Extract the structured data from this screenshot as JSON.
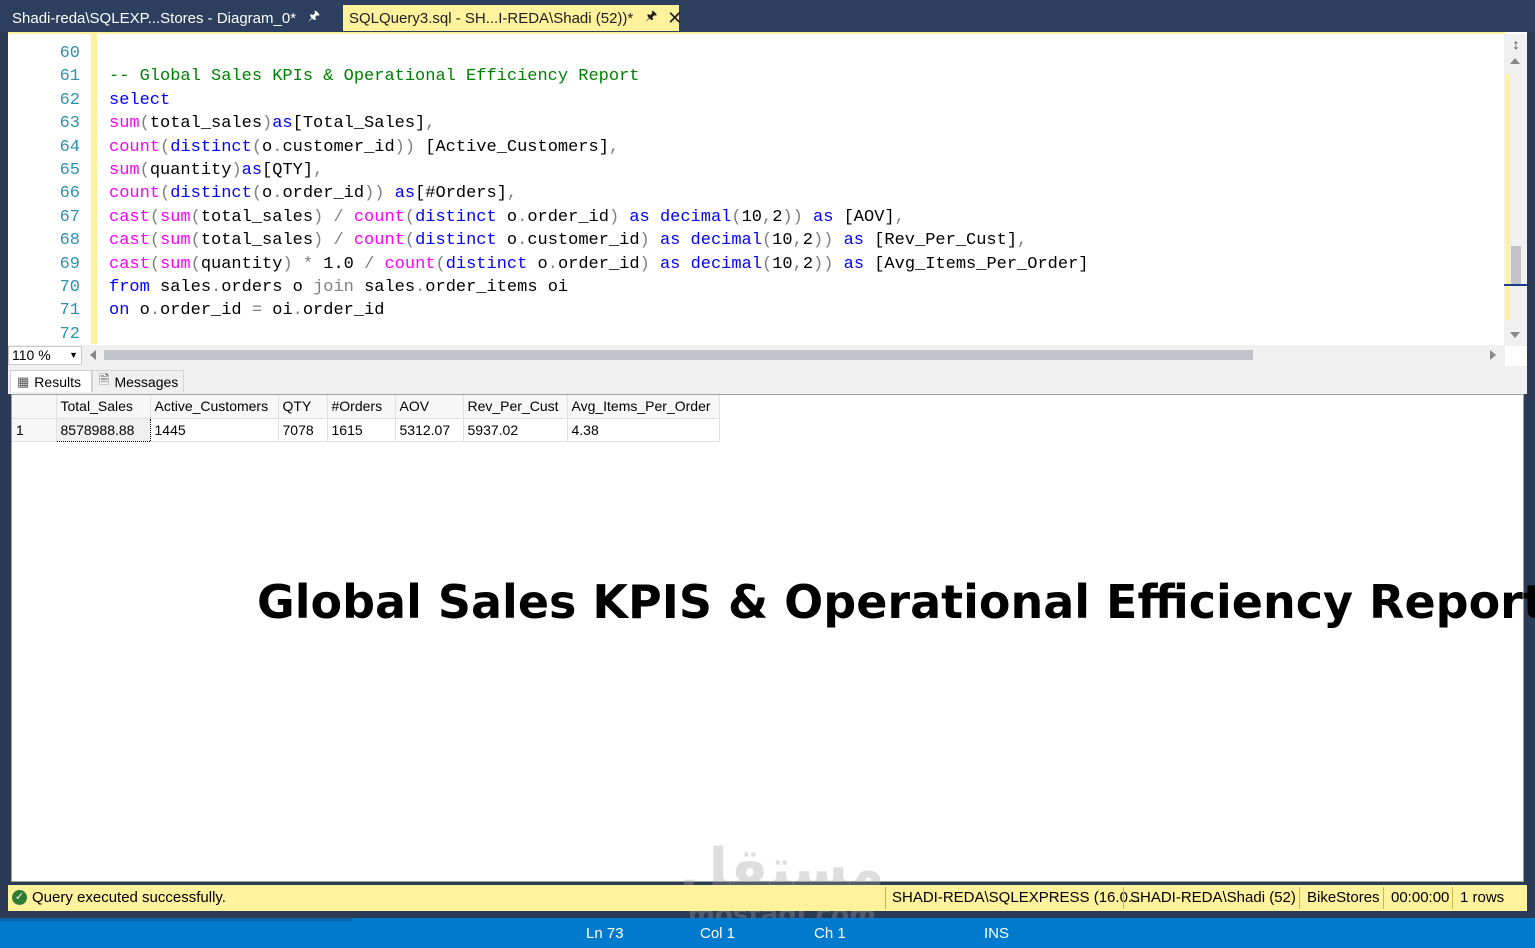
{
  "tabs": [
    {
      "label": "Shadi-reda\\SQLEXP...Stores - Diagram_0*",
      "pin": "⌕"
    },
    {
      "label": "SQLQuery3.sql - SH...I-REDA\\Shadi (52))*",
      "pin": "⌕",
      "close": "✕"
    }
  ],
  "editor": {
    "line_numbers": [
      "60",
      "61",
      "62",
      "63",
      "64",
      "65",
      "66",
      "67",
      "68",
      "69",
      "70",
      "71",
      "72"
    ],
    "lines": [
      {
        "parts": []
      },
      {
        "parts": [
          {
            "t": "-- Global Sales KPIs & Operational Efficiency Report",
            "c": "cm"
          }
        ]
      },
      {
        "parts": [
          {
            "t": "select",
            "c": "kw"
          }
        ]
      },
      {
        "parts": [
          {
            "t": "sum",
            "c": "fn"
          },
          {
            "t": "(",
            "c": "op"
          },
          {
            "t": "total_sales",
            "c": ""
          },
          {
            "t": ")",
            "c": "op"
          },
          {
            "t": "as",
            "c": "kw"
          },
          {
            "t": "[Total_Sales]",
            "c": ""
          },
          {
            "t": ",",
            "c": "op"
          }
        ]
      },
      {
        "parts": [
          {
            "t": "count",
            "c": "fn"
          },
          {
            "t": "(",
            "c": "op"
          },
          {
            "t": "distinct",
            "c": "kw"
          },
          {
            "t": "(",
            "c": "op"
          },
          {
            "t": "o",
            "c": ""
          },
          {
            "t": ".",
            "c": "op"
          },
          {
            "t": "customer_id",
            "c": ""
          },
          {
            "t": ")) ",
            "c": "op"
          },
          {
            "t": "[Active_Customers]",
            "c": ""
          },
          {
            "t": ",",
            "c": "op"
          }
        ]
      },
      {
        "parts": [
          {
            "t": "sum",
            "c": "fn"
          },
          {
            "t": "(",
            "c": "op"
          },
          {
            "t": "quantity",
            "c": ""
          },
          {
            "t": ")",
            "c": "op"
          },
          {
            "t": "as",
            "c": "kw"
          },
          {
            "t": "[QTY]",
            "c": ""
          },
          {
            "t": ",",
            "c": "op"
          }
        ]
      },
      {
        "parts": [
          {
            "t": "count",
            "c": "fn"
          },
          {
            "t": "(",
            "c": "op"
          },
          {
            "t": "distinct",
            "c": "kw"
          },
          {
            "t": "(",
            "c": "op"
          },
          {
            "t": "o",
            "c": ""
          },
          {
            "t": ".",
            "c": "op"
          },
          {
            "t": "order_id",
            "c": ""
          },
          {
            "t": ")) ",
            "c": "op"
          },
          {
            "t": "as",
            "c": "kw"
          },
          {
            "t": "[#Orders]",
            "c": ""
          },
          {
            "t": ",",
            "c": "op"
          }
        ]
      },
      {
        "parts": [
          {
            "t": "cast",
            "c": "fn"
          },
          {
            "t": "(",
            "c": "op"
          },
          {
            "t": "sum",
            "c": "fn"
          },
          {
            "t": "(",
            "c": "op"
          },
          {
            "t": "total_sales",
            "c": ""
          },
          {
            "t": ") / ",
            "c": "op"
          },
          {
            "t": "count",
            "c": "fn"
          },
          {
            "t": "(",
            "c": "op"
          },
          {
            "t": "distinct",
            "c": "kw"
          },
          {
            "t": " o",
            "c": ""
          },
          {
            "t": ".",
            "c": "op"
          },
          {
            "t": "order_id",
            "c": ""
          },
          {
            "t": ") ",
            "c": "op"
          },
          {
            "t": "as",
            "c": "kw"
          },
          {
            "t": " ",
            "c": ""
          },
          {
            "t": "decimal",
            "c": "kw"
          },
          {
            "t": "(",
            "c": "op"
          },
          {
            "t": "10",
            "c": ""
          },
          {
            "t": ",",
            "c": "op"
          },
          {
            "t": "2",
            "c": ""
          },
          {
            "t": ")) ",
            "c": "op"
          },
          {
            "t": "as",
            "c": "kw"
          },
          {
            "t": " [AOV]",
            "c": ""
          },
          {
            "t": ",",
            "c": "op"
          }
        ]
      },
      {
        "parts": [
          {
            "t": "cast",
            "c": "fn"
          },
          {
            "t": "(",
            "c": "op"
          },
          {
            "t": "sum",
            "c": "fn"
          },
          {
            "t": "(",
            "c": "op"
          },
          {
            "t": "total_sales",
            "c": ""
          },
          {
            "t": ") / ",
            "c": "op"
          },
          {
            "t": "count",
            "c": "fn"
          },
          {
            "t": "(",
            "c": "op"
          },
          {
            "t": "distinct",
            "c": "kw"
          },
          {
            "t": " o",
            "c": ""
          },
          {
            "t": ".",
            "c": "op"
          },
          {
            "t": "customer_id",
            "c": ""
          },
          {
            "t": ") ",
            "c": "op"
          },
          {
            "t": "as",
            "c": "kw"
          },
          {
            "t": " ",
            "c": ""
          },
          {
            "t": "decimal",
            "c": "kw"
          },
          {
            "t": "(",
            "c": "op"
          },
          {
            "t": "10",
            "c": ""
          },
          {
            "t": ",",
            "c": "op"
          },
          {
            "t": "2",
            "c": ""
          },
          {
            "t": ")) ",
            "c": "op"
          },
          {
            "t": "as",
            "c": "kw"
          },
          {
            "t": " [Rev_Per_Cust]",
            "c": ""
          },
          {
            "t": ",",
            "c": "op"
          }
        ]
      },
      {
        "parts": [
          {
            "t": "cast",
            "c": "fn"
          },
          {
            "t": "(",
            "c": "op"
          },
          {
            "t": "sum",
            "c": "fn"
          },
          {
            "t": "(",
            "c": "op"
          },
          {
            "t": "quantity",
            "c": ""
          },
          {
            "t": ") * ",
            "c": "op"
          },
          {
            "t": "1.0",
            "c": ""
          },
          {
            "t": " / ",
            "c": "op"
          },
          {
            "t": "count",
            "c": "fn"
          },
          {
            "t": "(",
            "c": "op"
          },
          {
            "t": "distinct",
            "c": "kw"
          },
          {
            "t": " o",
            "c": ""
          },
          {
            "t": ".",
            "c": "op"
          },
          {
            "t": "order_id",
            "c": ""
          },
          {
            "t": ") ",
            "c": "op"
          },
          {
            "t": "as",
            "c": "kw"
          },
          {
            "t": " ",
            "c": ""
          },
          {
            "t": "decimal",
            "c": "kw"
          },
          {
            "t": "(",
            "c": "op"
          },
          {
            "t": "10",
            "c": ""
          },
          {
            "t": ",",
            "c": "op"
          },
          {
            "t": "2",
            "c": ""
          },
          {
            "t": ")) ",
            "c": "op"
          },
          {
            "t": "as",
            "c": "kw"
          },
          {
            "t": " [Avg_Items_Per_Order]",
            "c": ""
          }
        ]
      },
      {
        "parts": [
          {
            "t": "from",
            "c": "kw"
          },
          {
            "t": " sales",
            "c": ""
          },
          {
            "t": ".",
            "c": "op"
          },
          {
            "t": "orders o ",
            "c": ""
          },
          {
            "t": "join",
            "c": "op"
          },
          {
            "t": " sales",
            "c": ""
          },
          {
            "t": ".",
            "c": "op"
          },
          {
            "t": "order_items oi",
            "c": ""
          }
        ]
      },
      {
        "parts": [
          {
            "t": "on",
            "c": "kw"
          },
          {
            "t": " o",
            "c": ""
          },
          {
            "t": ".",
            "c": "op"
          },
          {
            "t": "order_id ",
            "c": ""
          },
          {
            "t": "=",
            "c": "op"
          },
          {
            "t": " oi",
            "c": ""
          },
          {
            "t": ".",
            "c": "op"
          },
          {
            "t": "order_id",
            "c": ""
          }
        ]
      },
      {
        "parts": []
      }
    ],
    "zoom": "110 %"
  },
  "results_tabs": [
    {
      "label": "Results",
      "icon": "grid-icon"
    },
    {
      "label": "Messages",
      "icon": "messages-icon"
    }
  ],
  "grid": {
    "columns": [
      "Total_Sales",
      "Active_Customers",
      "QTY",
      "#Orders",
      "AOV",
      "Rev_Per_Cust",
      "Avg_Items_Per_Order"
    ],
    "rows": [
      {
        "num": "1",
        "cells": [
          "8578988.88",
          "1445",
          "7078",
          "1615",
          "5312.07",
          "5937.02",
          "4.38"
        ]
      }
    ]
  },
  "overlay_title": "Global Sales KPIS & Operational Efficiency Report",
  "watermark": {
    "arabic": "مستقل",
    "latin": "mostaql.com"
  },
  "query_status": {
    "message": "Query executed successfully.",
    "server": "SHADI-REDA\\SQLEXPRESS (16.0...",
    "user": "SHADI-REDA\\Shadi (52)",
    "database": "BikeStores",
    "elapsed": "00:00:00",
    "rows": "1 rows"
  },
  "app_status": {
    "ln": "Ln 73",
    "col": "Col 1",
    "ch": "Ch 1",
    "mode": "INS"
  },
  "colors": {
    "accent": "#007acc",
    "highlight": "#fff29d",
    "keyword": "#0000ff",
    "function": "#ff00ff",
    "comment": "#008000"
  }
}
